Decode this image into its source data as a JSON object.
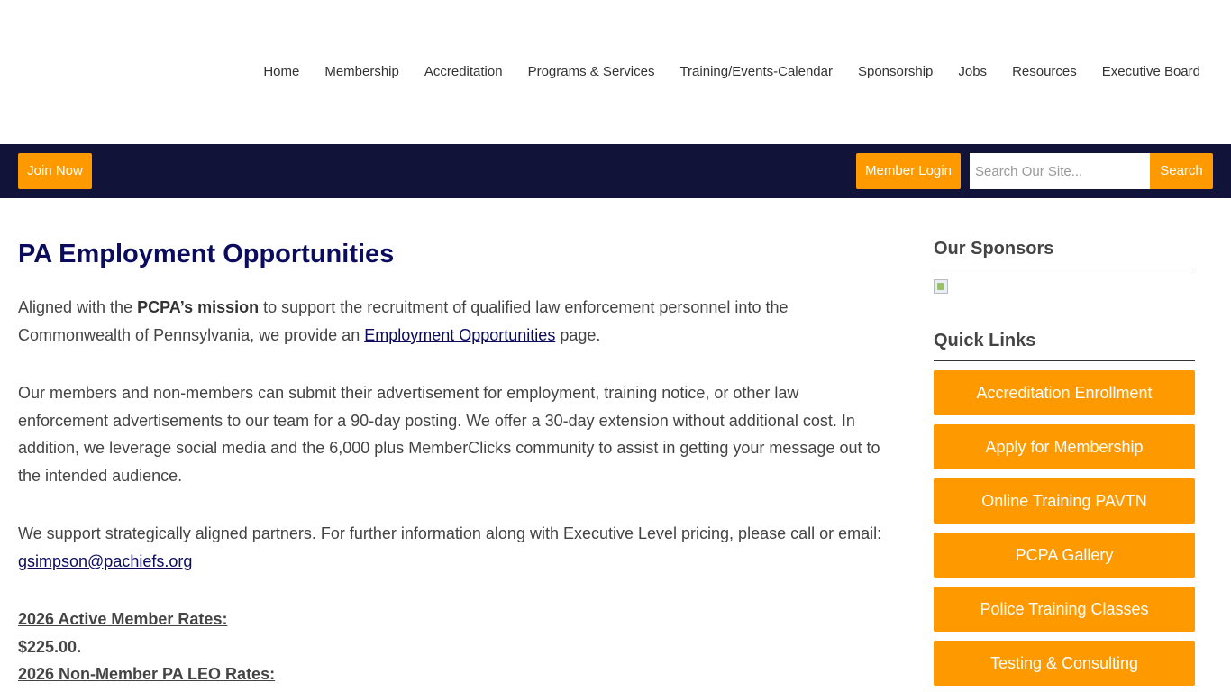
{
  "nav": {
    "items": [
      "Home",
      "Membership",
      "Accreditation",
      "Programs & Services",
      "Training/Events-Calendar",
      "Sponsorship",
      "Jobs",
      "Resources",
      "Executive Board"
    ]
  },
  "util": {
    "join_label": "Join Now",
    "login_label": "Member Login",
    "search_placeholder": "Search Our Site...",
    "search_label": "Search",
    "bar_color": "#121338",
    "accent_color": "#ff9900"
  },
  "main": {
    "title": "PA Employment Opportunities",
    "p1_a": "Aligned with the ",
    "p1_bold": "PCPA’s mission",
    "p1_b": " to support the recruitment of qualified law enforcement personnel into the Commonwealth of Pennsylvania, we provide an ",
    "p1_link": "Employment Opportunities",
    "p1_c": " page.",
    "p2": "Our members and non-members can submit their advertisement for employment, training notice, or other law enforcement advertisements to our team for a 90-day posting.  We offer a 30-day extension without additional cost.  In addition, we leverage social media and the 6,000 plus MemberClicks community to assist in getting your message out to the intended audience.",
    "p3_a": "We support strategically aligned partners.  For further information along with Executive Level pricing, please call or email: ",
    "p3_email": "gsimpson@pachiefs.org",
    "rates_1_heading": "2026 Active Member Rates:",
    "rates_1_value": "$225.00.",
    "rates_2_heading": "2026 Non-Member PA LEO Rates:"
  },
  "sidebar": {
    "sponsors_heading": "Our Sponsors",
    "quick_links_heading": "Quick Links",
    "quick_links": [
      "Accreditation Enrollment",
      "Apply for Membership",
      "Online Training PAVTN",
      "PCPA Gallery",
      "Police Training Classes",
      "Testing & Consulting"
    ]
  }
}
